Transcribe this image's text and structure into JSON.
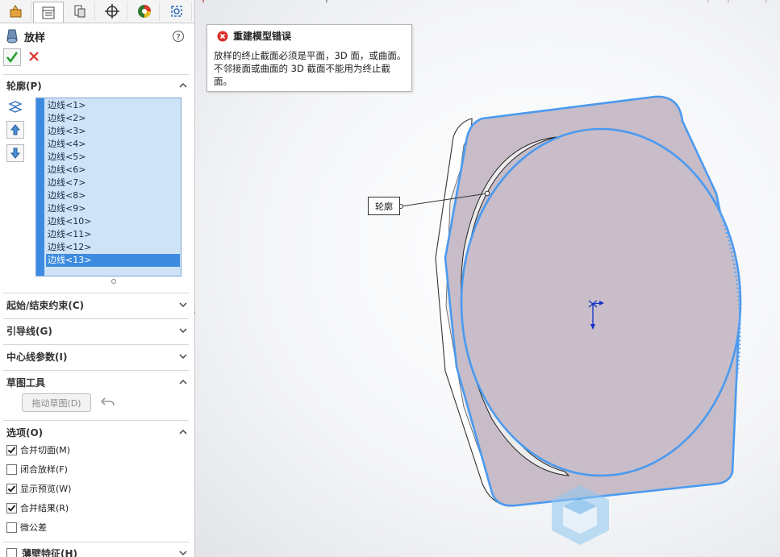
{
  "tabs": [
    {
      "name": "feature-manager",
      "icon": "feature-tree-icon"
    },
    {
      "name": "property-manager",
      "icon": "property-manager-icon"
    },
    {
      "name": "configuration-manager",
      "icon": "configuration-icon"
    },
    {
      "name": "dimxpert-manager",
      "icon": "crosshair-icon"
    },
    {
      "name": "display-manager",
      "icon": "appearance-icon"
    },
    {
      "name": "cam-manager",
      "icon": "cam-icon"
    }
  ],
  "feature": {
    "title": "放样",
    "help_icon": "help-icon",
    "ok_icon": "checkmark-icon",
    "cancel_icon": "close-icon"
  },
  "sections": {
    "profile": "轮廓(P)",
    "start_end": "起始/结束约束(C)",
    "guide": "引导线(G)",
    "centerline": "中心线参数(I)",
    "sketch_tools": "草图工具",
    "options": "选项(O)",
    "thin": "薄壁特征(H)"
  },
  "profile_items": [
    "边线<1>",
    "边线<2>",
    "边线<3>",
    "边线<4>",
    "边线<5>",
    "边线<6>",
    "边线<7>",
    "边线<8>",
    "边线<9>",
    "边线<10>",
    "边线<11>",
    "边线<12>",
    "边线<13>"
  ],
  "profile_selected_index": 12,
  "sketch_tools": {
    "drag_sketch": "拖动草图(D)"
  },
  "options": [
    {
      "label": "合并切面(M)",
      "checked": true
    },
    {
      "label": "闭合放样(F)",
      "checked": false
    },
    {
      "label": "显示预览(W)",
      "checked": true
    },
    {
      "label": "合并结果(R)",
      "checked": true
    },
    {
      "label": "微公差",
      "checked": false
    }
  ],
  "error": {
    "title": "重建模型错误",
    "message": "放样的终止截面必须是平面，3D 面，或曲面。不邻接面或曲面的 3D 截面不能用为终止截面。",
    "icon": "error-icon"
  },
  "callout_label": "轮廓",
  "colors": {
    "accent": "#3d8be0",
    "profile_face": "#c7bcc7",
    "edge_highlight": "#4a9af0",
    "error_red": "#d9302c"
  }
}
